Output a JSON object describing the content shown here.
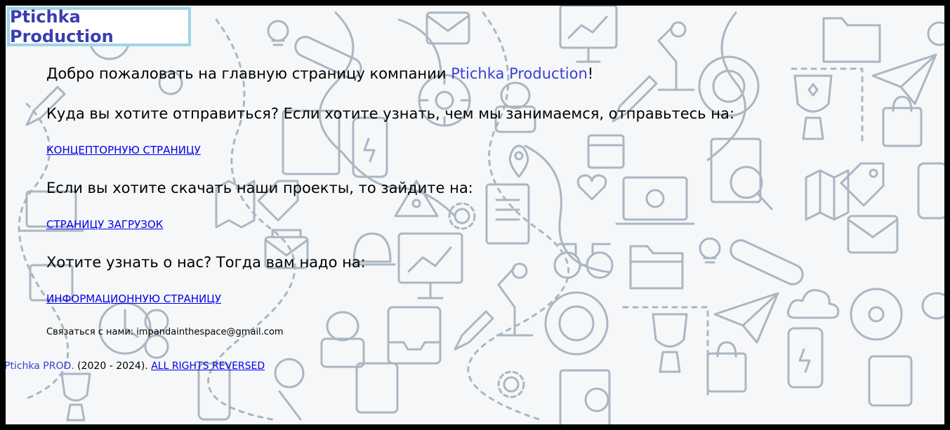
{
  "logo": {
    "text": "Ptichka Production"
  },
  "welcome": {
    "prefix": "Добро пожаловать на главную страницу компании ",
    "brand": "Ptichka Production",
    "suffix": "!"
  },
  "sections": [
    {
      "question": "Куда вы хотите отправиться? Если хотите узнать, чем мы занимаемся, отправьтесь на:",
      "link": "КОНЦЕПТОРНУЮ СТРАНИЦУ"
    },
    {
      "question": "Если вы хотите скачать наши проекты, то зайдите на:",
      "link": "СТРАНИЦУ ЗАГРУЗОК"
    },
    {
      "question": "Хотите узнать о нас? Тогда вам надо на:",
      "link": "ИНФОРМАЦИОННУЮ СТРАНИЦУ"
    }
  ],
  "contact": {
    "text": "Связаться с нами: impandainthespace@gmail.com"
  },
  "footer": {
    "brand": "Ptichka PROD.",
    "years": " (2020 - 2024). ",
    "rights": "ALL RIGHTS REVERSED"
  },
  "colors": {
    "frame": "#000000",
    "background": "#f6f7f8",
    "pattern": "#aab6c3",
    "logo_border": "#9fd5e6",
    "brand_text": "#3a3fd6",
    "link": "#0000ee"
  }
}
